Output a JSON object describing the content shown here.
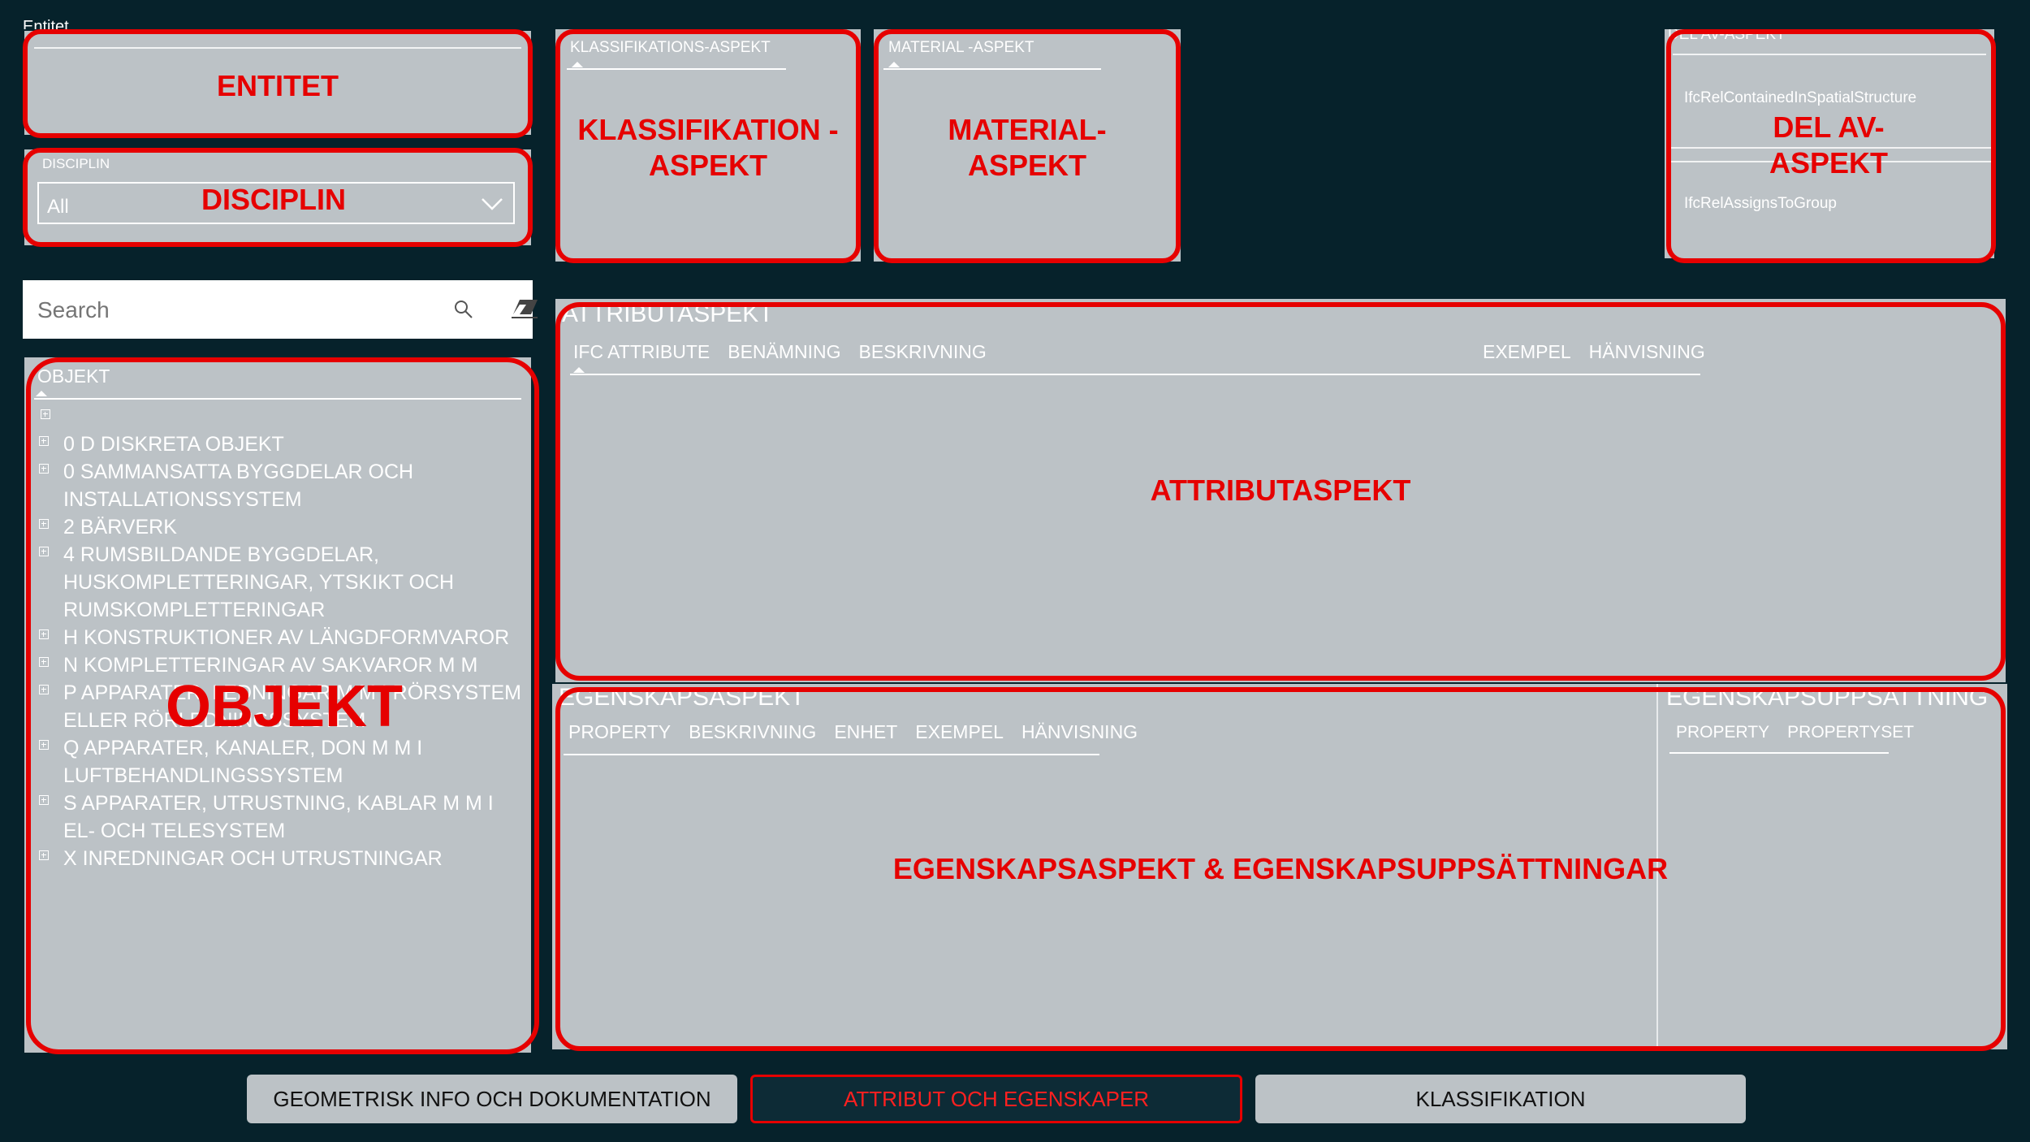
{
  "entitet": {
    "header": "Entitet",
    "annotation": "ENTITET"
  },
  "disciplin": {
    "header": "DISCIPLIN",
    "selected": "All",
    "annotation": "DISCIPLIN"
  },
  "search": {
    "placeholder": "Search"
  },
  "objekt": {
    "header": "OBJEKT",
    "annotation": "OBJEKT",
    "items": [
      "0 D DISKRETA OBJEKT",
      "0 SAMMANSATTA BYGGDELAR OCH INSTALLATIONSSYSTEM",
      "2 BÄRVERK",
      "4 RUMSBILDANDE BYGGDELAR, HUSKOMPLETTERINGAR, YTSKIKT OCH RUMSKOMPLETTERINGAR",
      "H KONSTRUKTIONER AV LÄNGDFORMVAROR",
      "N KOMPLETTERINGAR AV SAKVAROR M M",
      "P APPARATER, LEDNINGAR M M I RÖRSYSTEM ELLER RÖRLEDNINGSSYSTEM",
      "Q APPARATER, KANALER, DON M M I LUFTBEHANDLINGSSYSTEM",
      "S APPARATER, UTRUSTNING, KABLAR M M I EL- OCH TELESYSTEM",
      "X INREDNINGAR OCH UTRUSTNINGAR"
    ]
  },
  "klassifikation": {
    "header": "KLASSIFIKATIONS-ASPEKT",
    "annotation": "KLASSIFIKATION -\nASPEKT"
  },
  "material": {
    "header": "MATERIAL -ASPEKT",
    "annotation": "MATERIAL-\nASPEKT"
  },
  "delav": {
    "header": "DEL AV-ASPEKT",
    "annotation": "DEL AV-\nASPEKT",
    "items": [
      "IfcRelContainedInSpatialStructure",
      "IfcRelAssignsToGroup"
    ]
  },
  "attribut": {
    "header": "ATTRIBUTASPEKT",
    "annotation": "ATTRIBUTASPEKT",
    "columns_left": [
      "IFC ATTRIBUTE",
      "BENÄMNING",
      "BESKRIVNING"
    ],
    "columns_right": [
      "EXEMPEL",
      "HÄNVISNING"
    ]
  },
  "egenskap": {
    "header": "EGENSKAPSASPEKT",
    "columns": [
      "PROPERTY",
      "BESKRIVNING",
      "ENHET",
      "EXEMPEL",
      "HÄNVISNING"
    ],
    "annotation": "EGENSKAPSASPEKT & EGENSKAPSUPPSÄTTNINGAR"
  },
  "uppsattning": {
    "header": "EGENSKAPSUPPSATTNING",
    "columns": [
      "PROPERTY",
      "PROPERTYSET"
    ]
  },
  "tabs": [
    {
      "label": "GEOMETRISK INFO OCH DOKUMENTATION"
    },
    {
      "label": "ATTRIBUT OCH EGENSKAPER"
    },
    {
      "label": "KLASSIFIKATION"
    }
  ],
  "colors": {
    "background": "#06222b",
    "panel": "#bcc2c6",
    "highlight": "#e60000",
    "active_tab": "#0d2b36"
  }
}
